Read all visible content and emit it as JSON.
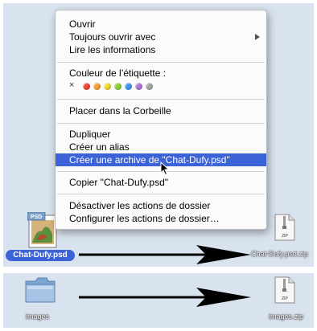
{
  "context_menu": {
    "items": [
      {
        "label": "Ouvrir"
      },
      {
        "label": "Toujours ouvrir avec"
      },
      {
        "label": "Lire les informations"
      },
      {
        "label": "Couleur de l’étiquette :"
      },
      {
        "label": "Placer dans la Corbeille"
      },
      {
        "label": "Dupliquer"
      },
      {
        "label": "Créer un alias"
      },
      {
        "label": "Créer une archive de \"Chat-Dufy.psd\""
      },
      {
        "label": "Copier \"Chat-Dufy.psd\""
      },
      {
        "label": "Désactiver les actions de dossier"
      },
      {
        "label": "Configurer les actions de dossier…"
      }
    ],
    "label_clear_symbol": "×",
    "label_colors": [
      "#f2483c",
      "#f7a033",
      "#f2de2e",
      "#8cd43b",
      "#3f9bf0",
      "#b178d8",
      "#a9a9a9"
    ]
  },
  "files": {
    "psd_badge": "PSD",
    "psd_name": "Chat-Dufy.psd",
    "zip_badge": "ZIP",
    "zip1_name": "Chat-Dufy.psd.zip",
    "folder_name": "images",
    "zip2_name": "images.zip"
  },
  "colors": {
    "selection": "#3b63d7",
    "desktop": "#d9e3ef",
    "folder": "#8fb3db"
  }
}
